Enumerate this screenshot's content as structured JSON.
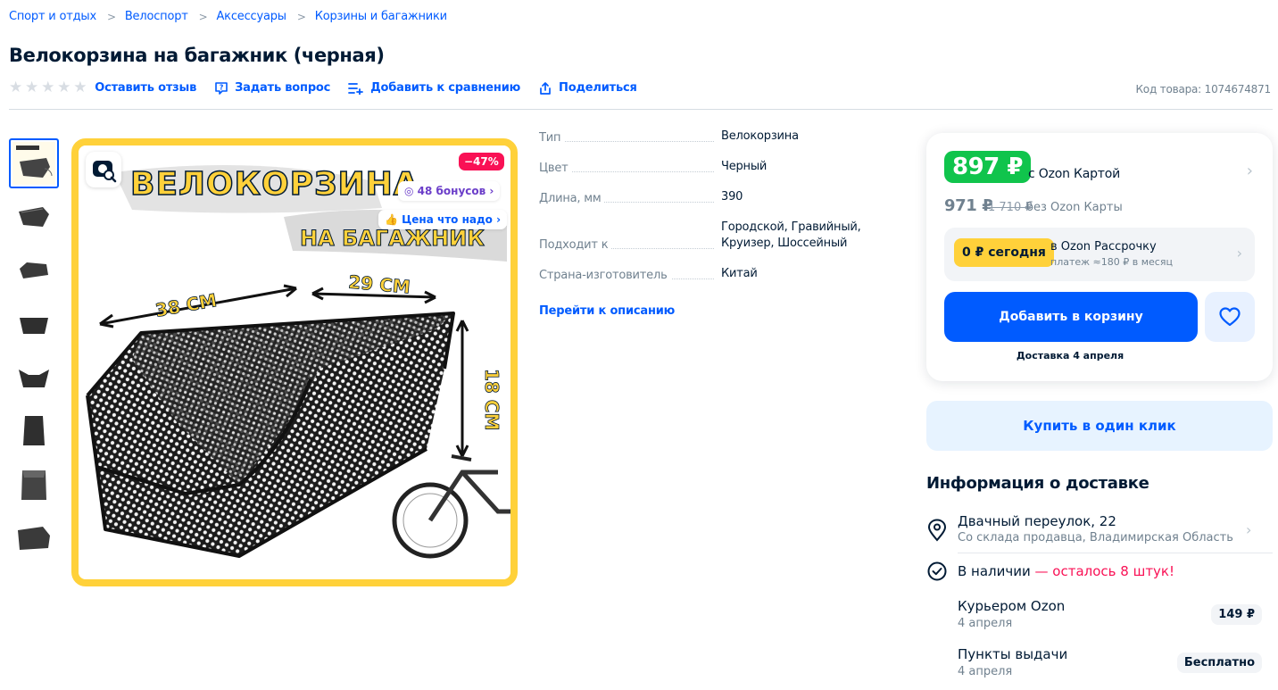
{
  "breadcrumb": [
    "Спорт и отдых",
    "Велоспорт",
    "Аксессуары",
    "Корзины и багажники"
  ],
  "product": {
    "title": "Велокорзина на багажник (черная)",
    "sku_label": "Код товара: 1074674871"
  },
  "actions": {
    "review": "Оставить отзыв",
    "question": "Задать вопрос",
    "compare": "Добавить к сравнению",
    "share": "Поделиться"
  },
  "image": {
    "discount": "−47%",
    "bonus": "48 бонусов",
    "fair_price": "Цена что надо",
    "headline1": "ВЕЛОКОРЗИНА",
    "headline2": "НА БАГАЖНИК",
    "dim_length": "38 СМ",
    "dim_width": "29 СМ",
    "dim_height": "18 СМ"
  },
  "specs": [
    {
      "key": "Тип",
      "value": "Велокорзина"
    },
    {
      "key": "Цвет",
      "value": "Черный"
    },
    {
      "key": "Длина, мм",
      "value": "390"
    },
    {
      "key": "Подходит к",
      "value": "Городской, Гравийный, Круизер, Шоссейный"
    },
    {
      "key": "Страна-изготовитель",
      "value": "Китай"
    }
  ],
  "desc_link": "Перейти к описанию",
  "price": {
    "card_price": "897 ₽",
    "card_label": "с Ozon Картой",
    "regular_price": "971 ₽",
    "old_price": "1 710 ₽",
    "regular_label": "без Ozon Карты",
    "installment_pill": "0 ₽ сегодня",
    "installment_title": "в Ozon Рассрочку",
    "installment_sub": "платеж ≈180 ₽ в месяц",
    "add_to_cart": "Добавить в корзину",
    "delivery_date": "Доставка 4 апреля",
    "one_click": "Купить в один клик"
  },
  "delivery": {
    "heading": "Информация о доставке",
    "address": "Двачный переулок, 22",
    "address_sub": "Со склада продавца, Владимирская Область",
    "stock": "В наличии",
    "stock_left": " — осталось 8 штук!",
    "options": [
      {
        "name": "Курьером Ozon",
        "date": "4 апреля",
        "price": "149 ₽"
      },
      {
        "name": "Пункты выдачи",
        "date": "4 апреля",
        "price": "Бесплатно"
      }
    ]
  },
  "colors": {
    "accent": "#005bff",
    "green": "#10c44c",
    "yellow": "#ffd13a",
    "sale": "#f91155"
  }
}
